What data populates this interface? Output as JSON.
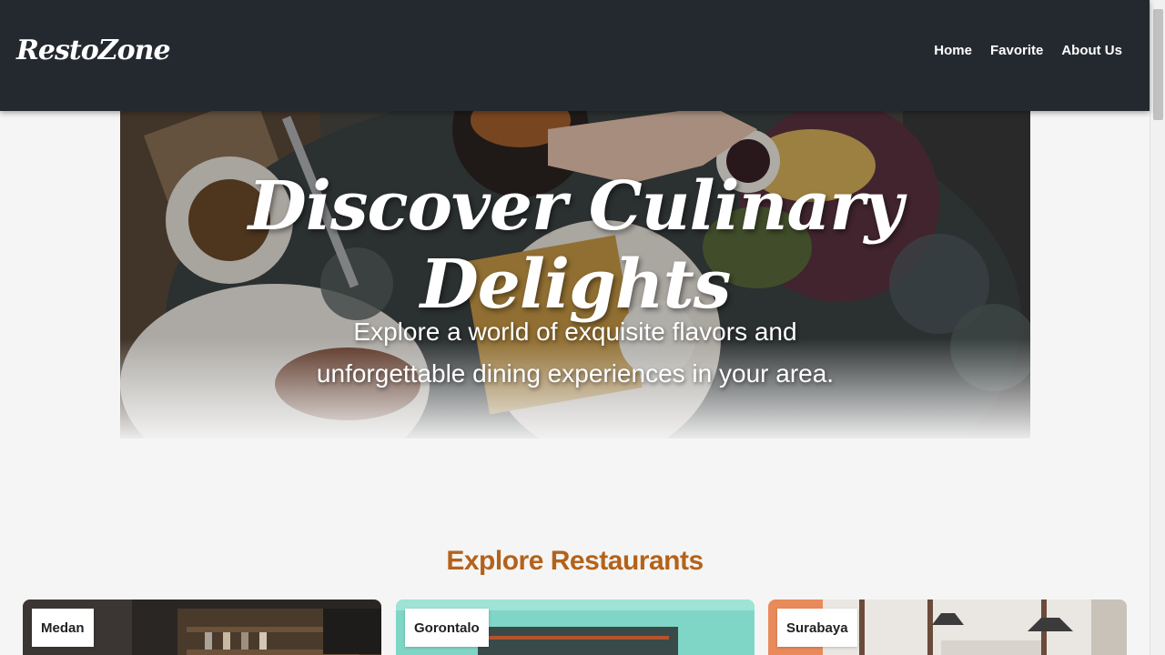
{
  "header": {
    "brand": "RestoZone",
    "nav": [
      {
        "label": "Home"
      },
      {
        "label": "Favorite"
      },
      {
        "label": "About Us"
      }
    ]
  },
  "hero": {
    "title": "Discover Culinary Delights",
    "subtitle": "Explore a world of exquisite flavors and unforgettable dining experiences in your area."
  },
  "explore": {
    "title": "Explore Restaurants",
    "cards": [
      {
        "city": "Medan"
      },
      {
        "city": "Gorontalo"
      },
      {
        "city": "Surabaya"
      }
    ]
  },
  "colors": {
    "app_bar": "#23292f",
    "accent": "#b4621a",
    "background": "#f5f5f5"
  },
  "icons": []
}
